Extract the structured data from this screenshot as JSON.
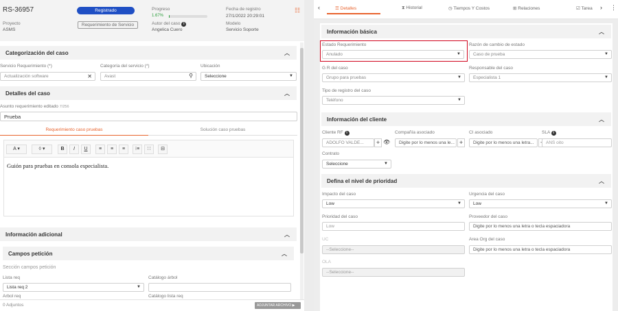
{
  "left": {
    "case_id": "RS-36957",
    "status_badge": "Registrado",
    "progress_label": "Progreso",
    "progress_pct_text": "1.67%",
    "progress_pct": 1.67,
    "date_label": "Fecha de registro",
    "date_value": "27/1/2022 20:29:01",
    "project_label": "Proyecto",
    "project_value": "ASMS",
    "service_req_button": "Requerimiento de Servicio",
    "author_label": "Autor del caso",
    "author_value": "Angelica Cuero",
    "model_label": "Modelo",
    "model_value": "Servicio Soporte",
    "cat_section": "Categorización del caso",
    "svc_req_label": "Servicio Requerimiento (*)",
    "svc_req_value": "Actualización software",
    "svc_cat_label": "Categoría del servicio (*)",
    "svc_cat_value": "Avast",
    "location_label": "Ubicación",
    "location_value": "Seleccione",
    "details_section": "Detalles del caso",
    "subject_label": "Asunto requerimiento editado",
    "subject_count": "7/256",
    "subject_value": "Prueba",
    "tab_req": "Requerimiento caso pruebas",
    "tab_sol": "Solución caso pruebas",
    "editor_text": "Guión para pruebas en consola especialista.",
    "toolbar": {
      "font": "A",
      "color": "◊",
      "bold": "B",
      "italic": "I",
      "underline": "U"
    },
    "add_info_section": "Información adicional",
    "fields_section": "Campos petición",
    "fields_subtitle": "Sección campos petición",
    "list_req_label": "Lista req",
    "list_req_value": "Lista req 2",
    "catalog_label": "Catálogo árbol",
    "arbol_label": "Arbol req",
    "catalog_list_label": "Catálogo lista req",
    "attachments": "0 Adjuntos",
    "attach_button": "ADJUNTAR ARCHIVO"
  },
  "right": {
    "tabs": [
      "Detalles",
      "Historial",
      "Tiempos Y Costos",
      "Relaciones",
      "Tarea"
    ],
    "basic_section": "Información básica",
    "state_label": "Estado Requerimiento",
    "state_value": "Anulado",
    "reason_label": "Razón de cambio de estado",
    "reason_value": "Caso de prueba",
    "group_label": "G R del caso",
    "group_value": "Grupo para pruebas",
    "resp_label": "Responsable del caso",
    "resp_value": "Especialista 1",
    "reg_type_label": "Tipo de registro del caso",
    "reg_type_value": "Teléfono",
    "client_section": "Información del cliente",
    "client_rf_label": "Cliente RF",
    "client_rf_value": "ADOLFO VALDE...",
    "company_label": "Compañía asociado",
    "company_placeholder": "Digite por lo menos una le...",
    "ci_label": "CI asociado",
    "ci_placeholder": "Digite por lo menos una letra...",
    "sla_label": "SLA",
    "sla_value": "ANS oito",
    "contract_label": "Contrato",
    "contract_value": "Seleccione",
    "priority_section": "Defina el nivel de prioridad",
    "impact_label": "Impacto del caso",
    "impact_value": "Low",
    "urgency_label": "Urgencia del caso",
    "urgency_value": "Low",
    "priority_label": "Prioridad del caso",
    "priority_value": "Low",
    "provider_label": "Proveedor del caso",
    "provider_placeholder": "Digite por lo menos una letra o tecla espaciadora",
    "uc_label": "UC",
    "uc_value": "--Seleccione--",
    "area_label": "Area Org del caso",
    "area_placeholder": "Digite por lo menos una letra o tecla espaciadora",
    "ola_label": "OLA",
    "ola_value": "--Seleccione--"
  },
  "colors": {
    "accent": "#e8622c",
    "badge": "#1f4fc4",
    "highlight": "#d0021b",
    "progress": "#2a9d3a"
  }
}
